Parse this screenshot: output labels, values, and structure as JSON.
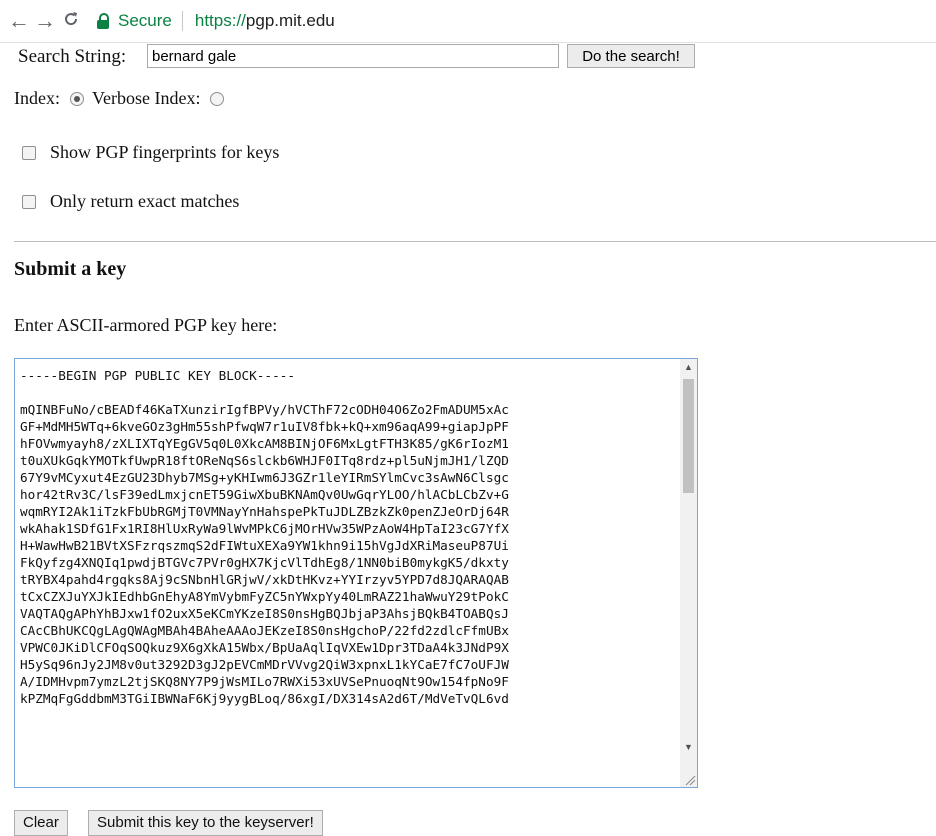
{
  "browser": {
    "back_icon": "←",
    "forward_icon": "→",
    "reload_icon": "⟳",
    "secure_label": "Secure",
    "url_scheme": "https://",
    "url_host": "pgp.mit.edu"
  },
  "search": {
    "label": "Search String:",
    "input_value": "bernard gale",
    "button_label": "Do the search!"
  },
  "options": {
    "index_label": "Index:",
    "verbose_label": "Verbose Index:",
    "fingerprint_label": "Show PGP fingerprints for keys",
    "exact_label": "Only return exact matches"
  },
  "submit_section": {
    "heading": "Submit a key",
    "prompt": "Enter ASCII-armored PGP key here:",
    "key_lines": [
      "-----BEGIN PGP PUBLIC KEY BLOCK-----",
      "",
      "mQINBFuNo/cBEADf46KaTXunzirIgfBPVy/hVCThF72cODH04O6Zo2FmADUM5xAc",
      "GF+MdMH5WTq+6kveGOz3gHm55shPfwqW7r1uIV8fbk+kQ+xm96aqA99+giapJpPF",
      "hFOVwmyayh8/zXLIXTqYEgGV5q0L0XkcAM8BINjOF6MxLgtFTH3K85/gK6rIozM1",
      "t0uXUkGqkYMOTkfUwpR18ftOReNqS6slckb6WHJF0ITq8rdz+pl5uNjmJH1/lZQD",
      "67Y9vMCyxut4EzGU23Dhyb7MSg+yKHIwm6J3GZr1leYIRmSYlmCvc3sAwN6Clsgc",
      "hor42tRv3C/lsF39edLmxjcnET59GiwXbuBKNAmQv0UwGqrYLOO/hlACbLCbZv+G",
      "wqmRYI2Ak1iTzkFbUbRGMjT0VMNayYnHahspePkTuJDLZBzkZk0penZJeOrDj64R",
      "wkAhak1SDfG1Fx1RI8HlUxRyWa9lWvMPkC6jMOrHVw35WPzAoW4HpTaI23cG7YfX",
      "H+WawHwB21BVtXSFzrqszmqS2dFIWtuXEXa9YW1khn9i15hVgJdXRiMaseuP87Ui",
      "FkQyfzg4XNQIq1pwdjBTGVc7PVr0gHX7KjcVlTdhEg8/1NN0biB0mykgK5/dkxty",
      "tRYBX4pahd4rgqks8Aj9cSNbnHlGRjwV/xkDtHKvz+YYIrzyv5YPD7d8JQARAQAB",
      "tCxCZXJuYXJkIEdhbGnEhyA8YmVybmFyZC5nYWxpYy40LmRAZ21haWwuY29tPokC",
      "VAQTAQgAPhYhBJxw1fO2uxX5eKCmYKzeI8S0nsHgBQJbjaP3AhsjBQkB4TOABQsJ",
      "CAcCBhUKCQgLAgQWAgMBAh4BAheAAAoJEKzeI8S0nsHgchoP/22fd2zdlcFfmUBx",
      "VPWC0JKiDlCFOqSOQkuz9X6gXkA15Wbx/BpUaAqlIqVXEw1Dpr3TDaA4k3JNdP9X",
      "H5ySq96nJy2JM8v0ut3292D3gJ2pEVCmMDrVVvg2QiW3xpnxL1kYCaE7fC7oUFJW",
      "A/IDMHvpm7ymzL2tjSKQ8NY7P9jWsMILo7RWXi53xUVSePnuoqNt9Ow154fpNo9F",
      "kPZMqFgGddbmM3TGiIBWNaF6Kj9yygBLoq/86xgI/DX314sA2d6T/MdVeTvQL6vd"
    ]
  },
  "buttons": {
    "clear_label": "Clear",
    "submit_label": "Submit this key to the keyserver!"
  }
}
